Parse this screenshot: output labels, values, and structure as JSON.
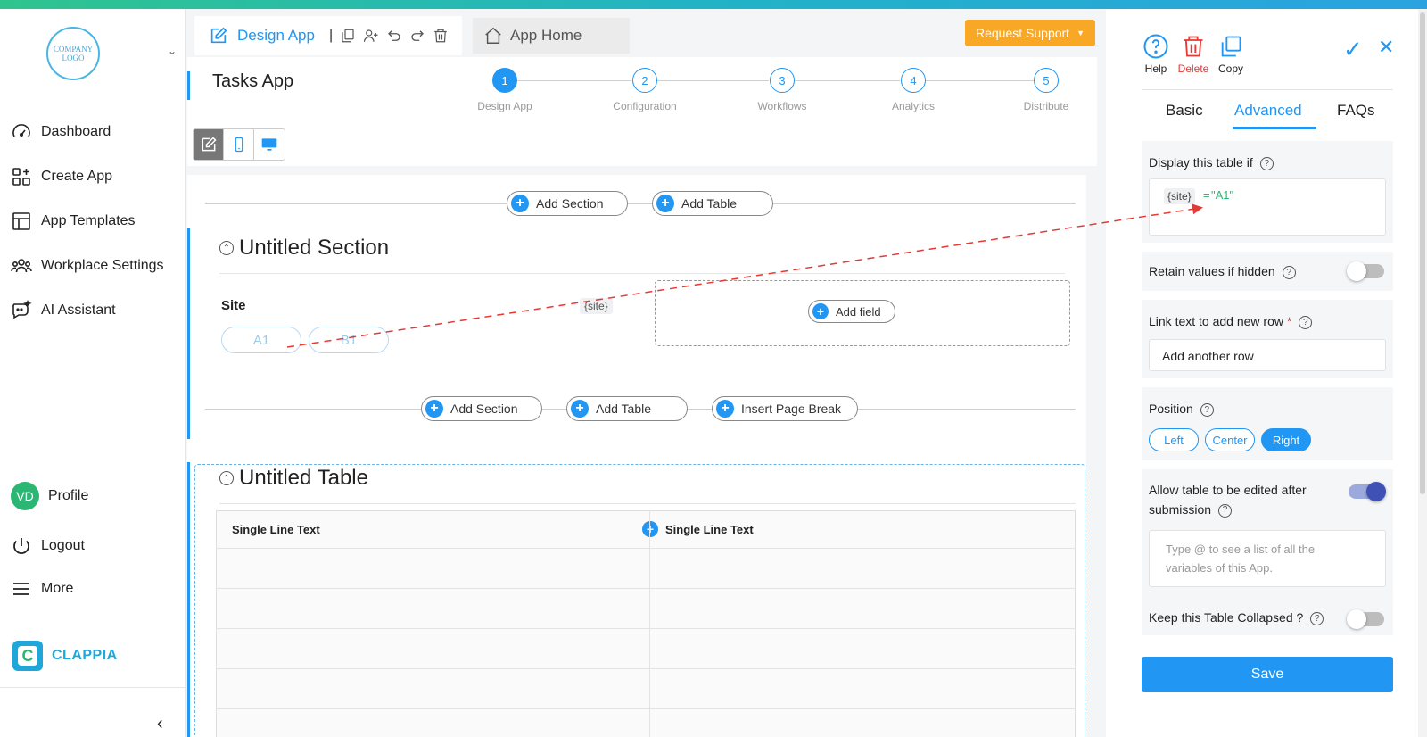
{
  "sidebar": {
    "logo_text": "COMPANY LOGO",
    "nav": [
      {
        "label": "Dashboard",
        "icon": "speedometer-icon"
      },
      {
        "label": "Create App",
        "icon": "grid-plus-icon"
      },
      {
        "label": "App Templates",
        "icon": "template-icon"
      },
      {
        "label": "Workplace Settings",
        "icon": "people-icon"
      },
      {
        "label": "AI Assistant",
        "icon": "chat-sparkle-icon"
      }
    ],
    "profile": {
      "initials": "VD",
      "label": "Profile"
    },
    "logout_label": "Logout",
    "more_label": "More",
    "brand_name": "CLAPPIA"
  },
  "tabbar": {
    "design_label": "Design App",
    "home_label": "App Home",
    "support_label": "Request Support"
  },
  "header": {
    "app_title": "Tasks App",
    "steps": [
      {
        "num": "1",
        "label": "Design App"
      },
      {
        "num": "2",
        "label": "Configuration"
      },
      {
        "num": "3",
        "label": "Workflows"
      },
      {
        "num": "4",
        "label": "Analytics"
      },
      {
        "num": "5",
        "label": "Distribute"
      }
    ]
  },
  "canvas": {
    "add_section": "Add Section",
    "add_table": "Add Table",
    "insert_page_break": "Insert Page Break",
    "section_title": "Untitled Section",
    "field_label": "Site",
    "options": [
      "A1",
      "B1"
    ],
    "var_tag": "{site}",
    "add_field": "Add field",
    "table_title": "Untitled Table",
    "table_columns": [
      "Single Line Text",
      "Single Line Text"
    ]
  },
  "panel": {
    "help_label": "Help",
    "delete_label": "Delete",
    "copy_label": "Copy",
    "tabs": [
      "Basic",
      "Advanced",
      "FAQs"
    ],
    "display_if_label": "Display this table if",
    "condition_var": "{site}",
    "condition_op": "=",
    "condition_value": "\"A1\"",
    "retain_label": "Retain values if hidden",
    "retain_on": false,
    "link_text_label": "Link text to add new row",
    "required_mark": "*",
    "link_text_value": "Add another row",
    "position_label": "Position",
    "position_options": [
      "Left",
      "Center",
      "Right"
    ],
    "position_selected": "Right",
    "allow_edit_label": "Allow table to be edited after submission",
    "allow_edit_on": true,
    "variables_placeholder": "Type @ to see a list of all the variables of this App.",
    "collapsed_label": "Keep this Table Collapsed ?",
    "collapsed_on": false,
    "save_label": "Save"
  },
  "colors": {
    "accent": "#2196f3",
    "support": "#f9a825",
    "delete": "#e53935",
    "brand": "#1fa7d9"
  }
}
